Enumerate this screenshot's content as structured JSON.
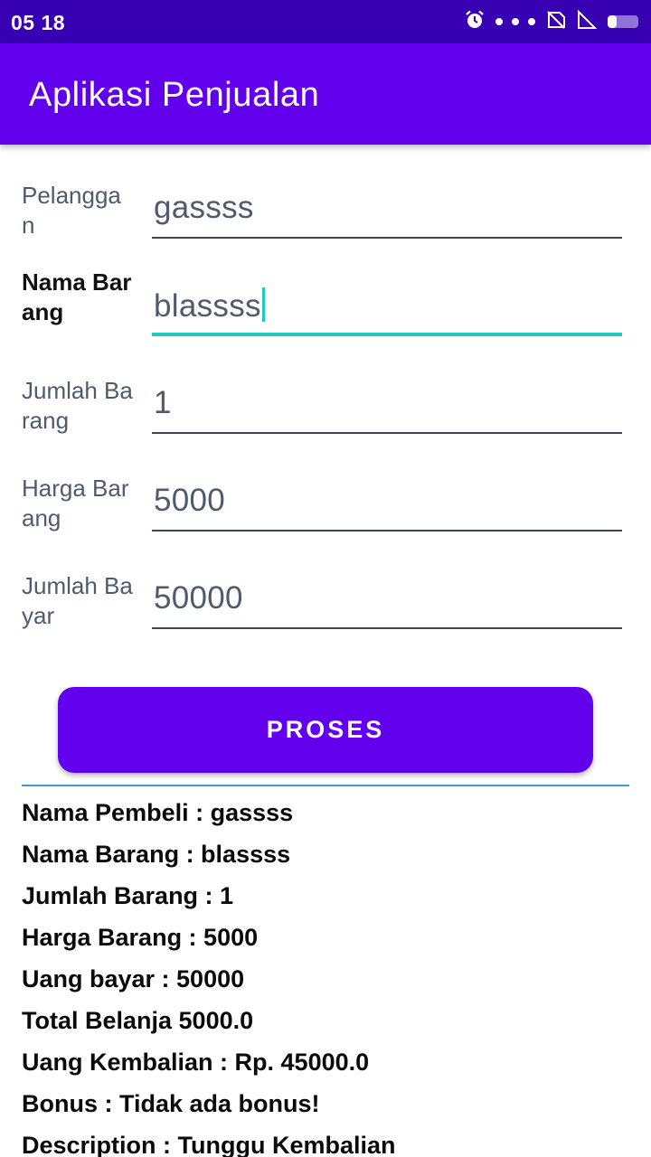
{
  "status_bar": {
    "time": "05 18",
    "icons": [
      "alarm-icon",
      "dots-icon",
      "no-sim-icon",
      "signal-icon",
      "battery-icon"
    ],
    "battery_level": 0.3
  },
  "app_bar": {
    "title": "Aplikasi Penjualan"
  },
  "form": {
    "fields": [
      {
        "label": "Pelanggan",
        "value": "gassss"
      },
      {
        "label": "Nama Barang",
        "value": "blassss"
      },
      {
        "label": "Jumlah Barang",
        "value": "1"
      },
      {
        "label": "Harga Barang",
        "value": "5000"
      },
      {
        "label": "Jumlah Bayar",
        "value": "50000"
      }
    ]
  },
  "button": {
    "label": "PROSES"
  },
  "results": [
    "Nama Pembeli : gassss",
    "Nama Barang : blassss",
    "Jumlah Barang : 1",
    "Harga Barang : 5000",
    "Uang bayar : 50000",
    "Total Belanja 5000.0",
    "Uang Kembalian : Rp. 45000.0",
    "Bonus : Tidak ada bonus!",
    "Description : Tunggu Kembalian"
  ],
  "colors": {
    "status_bar": "#3700b3",
    "primary": "#6200ee",
    "accent": "#1ecbc0",
    "divider": "#3a9fd6"
  }
}
